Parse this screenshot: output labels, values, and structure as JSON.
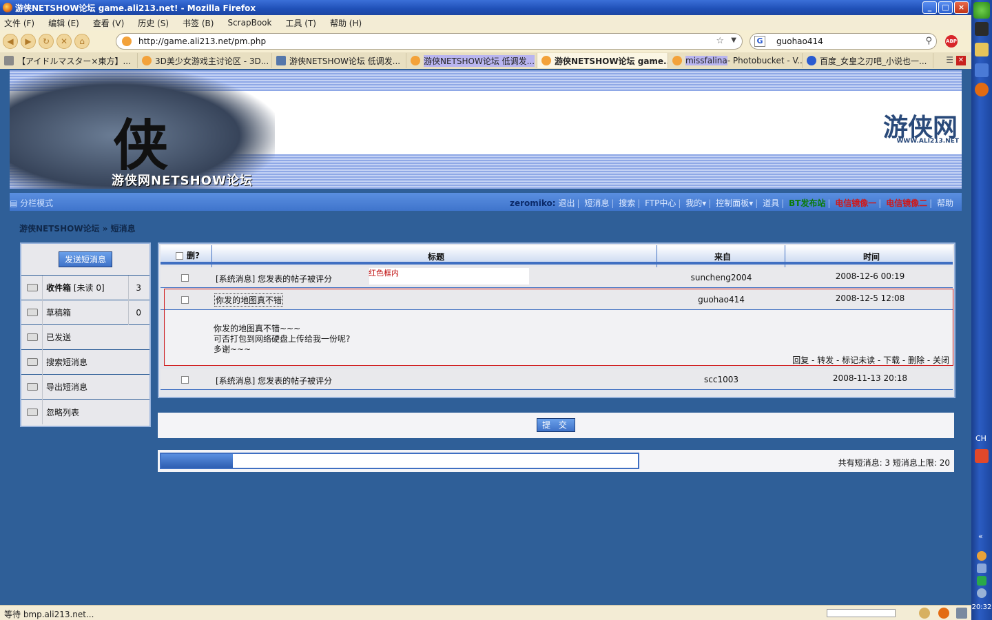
{
  "window": {
    "title": "游侠NETSHOW论坛 game.ali213.net! - Mozilla Firefox"
  },
  "menu": [
    "文件 (F)",
    "编辑 (E)",
    "查看 (V)",
    "历史 (S)",
    "书签 (B)",
    "ScrapBook",
    "工具 (T)",
    "帮助 (H)"
  ],
  "nav": {
    "url": "http://game.ali213.net/pm.php",
    "search_query": "guohao414",
    "abp_label": "ABP"
  },
  "tabs": [
    {
      "label": "【アイドルマスター×東方】..."
    },
    {
      "label": "3D美少女游戏主讨论区 - 3D..."
    },
    {
      "label": "游侠NETSHOW论坛 低调发..."
    },
    {
      "label": "游侠NETSHOW论坛 低调发..."
    },
    {
      "label": "游侠NETSHOW论坛 game..."
    },
    {
      "label_hl": "missfalina",
      "label_rest": " - Photobucket - V..."
    },
    {
      "label": "百度_女皇之刃吧_小说也一..."
    }
  ],
  "banner": {
    "char": "侠",
    "forum_name": "游侠网NETSHOW论坛",
    "logo": "游侠网",
    "logo_sub": "WWW.ALI213.NET"
  },
  "forum_nav": {
    "left": "分栏模式",
    "user": "zeromiko:",
    "links": [
      "退出",
      "短消息",
      "搜索",
      "FTP中心",
      "我的",
      "控制面板",
      "道具"
    ],
    "green": "BT发布站",
    "red1": "电信镜像一",
    "red2": "电信镜像二",
    "help": "帮助"
  },
  "breadcrumb": "游侠NETSHOW论坛 » 短消息",
  "sidebar": {
    "send_button": "发送短消息",
    "items": [
      {
        "label": "收件箱",
        "extra": "[未读 0]",
        "count": "3"
      },
      {
        "label": "草稿箱",
        "extra": "",
        "count": "0"
      },
      {
        "label": "已发送",
        "extra": "",
        "count": ""
      },
      {
        "label": "搜索短消息",
        "extra": "",
        "count": ""
      },
      {
        "label": "导出短消息",
        "extra": "",
        "count": ""
      },
      {
        "label": "忽略列表",
        "extra": "",
        "count": ""
      }
    ]
  },
  "table": {
    "headers": {
      "del": "删?",
      "subject": "标题",
      "from": "来自",
      "time": "时间"
    },
    "rows": [
      {
        "subject": "[系统消息] 您发表的帖子被评分",
        "from": "suncheng2004",
        "time": "2008-12-6 00:19"
      },
      {
        "subject": "你发的地图真不错",
        "from": "guohao414",
        "time": "2008-12-5 12:08"
      },
      {
        "subject": "[系统消息] 您发表的帖子被评分",
        "from": "scc1003",
        "time": "2008-11-13 20:18"
      }
    ],
    "note": "红色框内",
    "open_message": {
      "lines": [
        "你发的地图真不错~~~",
        "可否打包到网络硬盘上传给我一份呢?",
        "多谢~~~"
      ],
      "actions": "回复 - 转发 - 标记未读 - 下载 - 删除 - 关闭"
    }
  },
  "submit_label": "提 交",
  "quota": {
    "label": "共有短消息: 3 短消息上限: 20",
    "fraction": 0.15
  },
  "status": {
    "text": "等待 bmp.ali213.net..."
  },
  "taskbar": {
    "lang": "CH",
    "clock": "20:32"
  }
}
